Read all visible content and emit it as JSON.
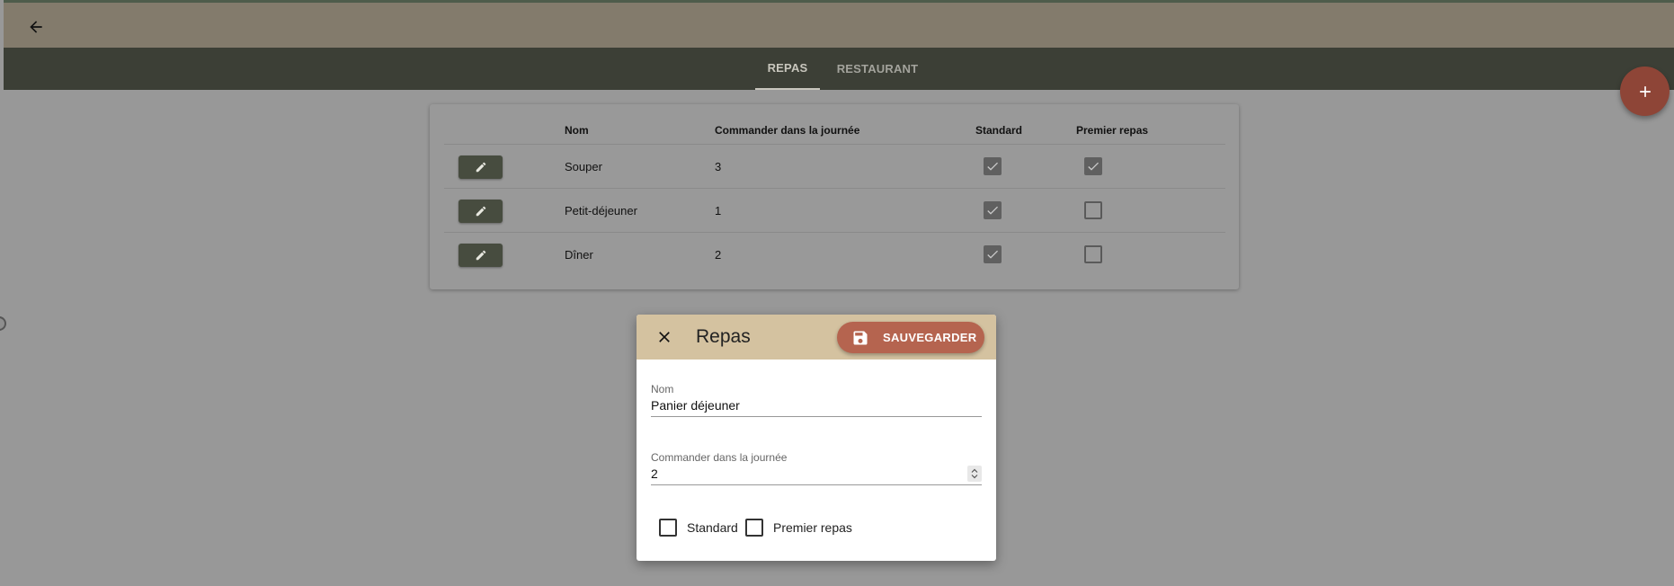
{
  "topbar": {
    "back_icon": "arrow-left-icon"
  },
  "tabs": [
    {
      "label": "REPAS",
      "active": true
    },
    {
      "label": "RESTAURANT",
      "active": false
    }
  ],
  "fab": {
    "icon": "plus-icon",
    "label": "+"
  },
  "table": {
    "columns": [
      "",
      "Nom",
      "Commander dans la journée",
      "Standard",
      "Premier repas"
    ],
    "rows": [
      {
        "nom": "Souper",
        "ordre": "3",
        "standard": true,
        "premier": true
      },
      {
        "nom": "Petit-déjeuner",
        "ordre": "1",
        "standard": true,
        "premier": false
      },
      {
        "nom": "Dîner",
        "ordre": "2",
        "standard": true,
        "premier": false
      }
    ]
  },
  "dialog": {
    "title": "Repas",
    "save_label": "SAUVEGARDER",
    "fields": {
      "nom": {
        "label": "Nom",
        "value": "Panier déjeuner"
      },
      "ordre": {
        "label": "Commander dans la journée",
        "value": "2"
      }
    },
    "checkboxes": {
      "standard": {
        "label": "Standard",
        "checked": false
      },
      "premier": {
        "label": "Premier repas",
        "checked": false
      }
    }
  },
  "colors": {
    "topbar": "#837b6c",
    "tabbar": "#3c3f36",
    "accent": "#b5644f",
    "fab": "#8e4537",
    "dialog_header": "#d4c2a0",
    "edit_button": "#474c3f"
  }
}
